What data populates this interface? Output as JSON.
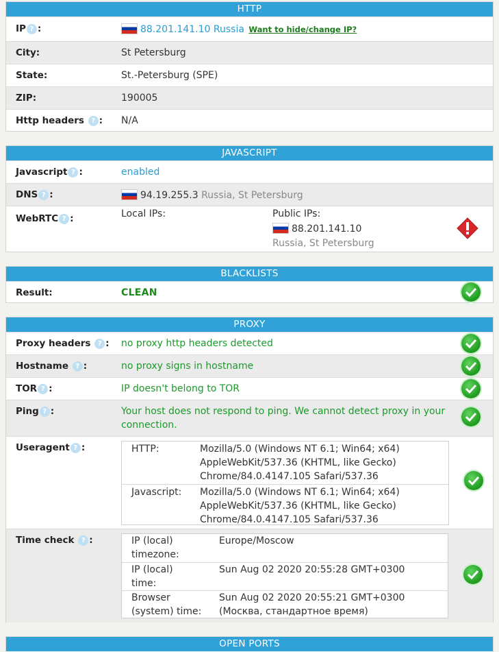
{
  "http": {
    "header": "HTTP",
    "ip_label": "IP",
    "ip_value": "88.201.141.10",
    "ip_country": "Russia",
    "hide_link": "Want to hide/change IP?",
    "city_label": "City:",
    "city_value": "St Petersburg",
    "state_label": "State:",
    "state_value": "St.-Petersburg (SPE)",
    "zip_label": "ZIP:",
    "zip_value": "190005",
    "headers_label": "Http headers",
    "headers_value": "N/A"
  },
  "javascript": {
    "header": "JAVASCRIPT",
    "js_label": "Javascript",
    "js_value": "enabled",
    "dns_label": "DNS",
    "dns_ip": "94.19.255.3",
    "dns_loc": "Russia, St Petersburg",
    "webrtc_label": "WebRTC",
    "local_ips": "Local IPs:",
    "public_ips": "Public IPs:",
    "public_ip": "88.201.141.10",
    "public_loc": "Russia, St Petersburg"
  },
  "blacklists": {
    "header": "BLACKLISTS",
    "result_label": "Result:",
    "result_value": "CLEAN"
  },
  "proxy": {
    "header": "PROXY",
    "proxy_headers_label": "Proxy headers",
    "proxy_headers_value": "no proxy http headers detected",
    "hostname_label": "Hostname",
    "hostname_value": "no proxy signs in hostname",
    "tor_label": "TOR",
    "tor_value": "IP doesn't belong to TOR",
    "ping_label": "Ping",
    "ping_value_1": "Your host does not respond to ping. We cannot detect proxy in your",
    "ping_value_2": "connection.",
    "ua_label": "Useragent",
    "ua_http_label": "HTTP:",
    "ua_http_1": "Mozilla/5.0 (Windows NT 6.1; Win64; x64)",
    "ua_http_2": "AppleWebKit/537.36 (KHTML, like Gecko)",
    "ua_http_3": "Chrome/84.0.4147.105 Safari/537.36",
    "ua_js_label": "Javascript:",
    "ua_js_1": "Mozilla/5.0 (Windows NT 6.1; Win64; x64)",
    "ua_js_2": "AppleWebKit/537.36 (KHTML, like Gecko)",
    "ua_js_3": "Chrome/84.0.4147.105 Safari/537.36",
    "time_label": "Time check",
    "tz_label_1": "IP (local)",
    "tz_label_2": "timezone:",
    "tz_value": "Europe/Moscow",
    "iptime_label_1": "IP (local)",
    "iptime_label_2": "time:",
    "iptime_value": "Sun Aug 02 2020 20:55:28 GMT+0300",
    "btime_label_1": "Browser",
    "btime_label_2": "(system) time:",
    "btime_value_1": "Sun Aug 02 2020 20:55:21 GMT+0300",
    "btime_value_2": "(Москва, стандартное время)"
  },
  "open_ports": {
    "header": "OPEN PORTS"
  },
  "icons": {
    "help": "question-icon",
    "ok": "check-icon",
    "warning": "warning-icon",
    "flag": "russia-flag-icon"
  },
  "colors": {
    "header_bg": "#31a2d8",
    "link_blue": "#2a9dd3",
    "ok_green": "#1c9a2b",
    "warn_red": "#d9262b"
  }
}
